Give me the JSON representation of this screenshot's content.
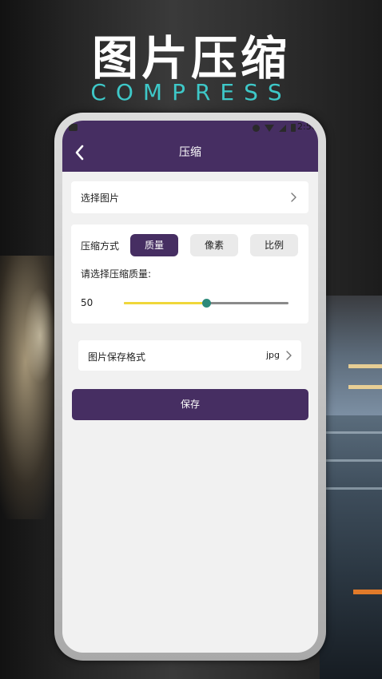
{
  "headline": {
    "title": "图片压缩",
    "subtitle": "COMPRESS"
  },
  "status_bar": {
    "time": "2:56"
  },
  "app_bar": {
    "title": "压缩"
  },
  "select_image": {
    "label": "选择图片"
  },
  "compress_method": {
    "label": "压缩方式",
    "options": [
      "质量",
      "像素",
      "比例"
    ],
    "selected": "质量",
    "prompt": "请选择压缩质量:",
    "quality_value": "50",
    "slider_fraction": 0.5
  },
  "save_format": {
    "label": "图片保存格式",
    "value": "jpg"
  },
  "save_button": {
    "label": "保存"
  },
  "colors": {
    "primary": "#462e62",
    "slider_fill": "#f0d73a",
    "slider_thumb": "#2d8a7a",
    "headline_sub": "#3ec8c8"
  }
}
